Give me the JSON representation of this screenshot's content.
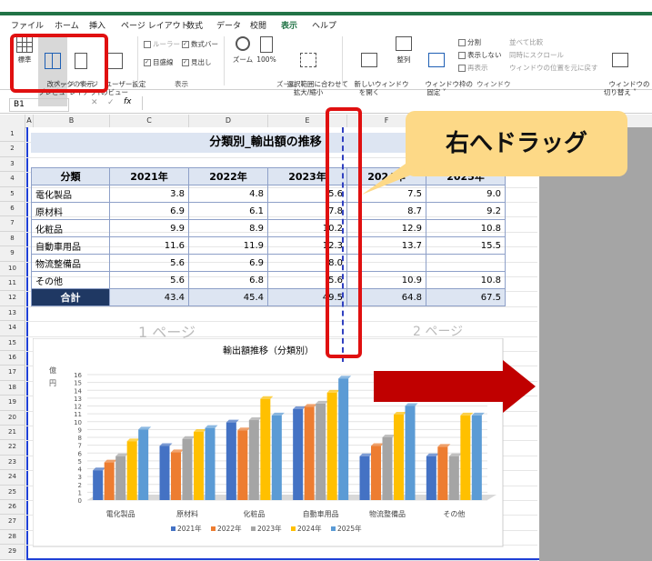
{
  "menu": [
    "ファイル",
    "ホーム",
    "挿入",
    "ページ レイアウト",
    "数式",
    "データ",
    "校閲",
    "表示",
    "ヘルプ"
  ],
  "menu_active": "表示",
  "ribbon": {
    "workbook_views": {
      "normal": "標準",
      "page_break": "改ページ\nプレビュー",
      "page_layout": "ページ\nレイアウト",
      "custom": "ユーザー設定\nのビュー",
      "group": "ブックの表示"
    },
    "show": {
      "ruler": "ルーラー",
      "formula_bar": "数式バー",
      "gridlines": "目盛線",
      "headings": "見出し",
      "group": "表示"
    },
    "zoom": {
      "zoom": "ズーム",
      "hundred": "100%",
      "selection": "選択範囲に合わせて\n拡大/縮小",
      "group": "ズーム"
    },
    "window": {
      "new_window": "新しいウィンドウ\nを開く",
      "arrange": "整列",
      "freeze": "ウィンドウ枠の\n固定 ˅",
      "split": "分割",
      "hide": "表示しない",
      "unhide": "再表示",
      "side": "並べて比較",
      "sync": "同時にスクロール",
      "reset": "ウィンドウの位置を元に戻す",
      "switch": "ウィンドウの\n切り替え ˅",
      "group": "ウィンドウ"
    }
  },
  "namebox": "B1",
  "fx": "fx",
  "columns": [
    "A",
    "B",
    "C",
    "D",
    "E",
    "F"
  ],
  "rows": [
    "1",
    "2",
    "3",
    "4",
    "5",
    "6",
    "7",
    "8",
    "9",
    "10",
    "11",
    "12",
    "13",
    "14",
    "15",
    "16",
    "17",
    "18",
    "19",
    "20",
    "21",
    "22",
    "23",
    "24",
    "25",
    "26",
    "27",
    "28",
    "29"
  ],
  "banner": "分類別_輸出額の推移",
  "table": {
    "headers": [
      "分類",
      "2021年",
      "2022年",
      "2023年",
      "2024年",
      "2025年"
    ],
    "rows": [
      [
        "電化製品",
        "3.8",
        "4.8",
        "5.6",
        "7.5",
        "9.0"
      ],
      [
        "原材料",
        "6.9",
        "6.1",
        "7.8",
        "8.7",
        "9.2"
      ],
      [
        "化粧品",
        "9.9",
        "8.9",
        "10.2",
        "12.9",
        "10.8"
      ],
      [
        "自動車用品",
        "11.6",
        "11.9",
        "12.3",
        "13.7",
        "15.5"
      ],
      [
        "物流整備品",
        "5.6",
        "6.9",
        "8.0",
        "",
        ""
      ],
      [
        "その他",
        "5.6",
        "6.8",
        "5.6",
        "10.9",
        "10.8"
      ]
    ],
    "total": [
      "合計",
      "43.4",
      "45.4",
      "49.5",
      "64.8",
      "67.5"
    ]
  },
  "page1": "1 ページ",
  "page2": "2 ページ",
  "callout": "右へドラッグ",
  "chart_data": {
    "type": "bar",
    "title": "輸出額推移（分類別）",
    "ylabel": "億\n円",
    "categories": [
      "電化製品",
      "原材料",
      "化粧品",
      "自動車用品",
      "物流整備品",
      "その他"
    ],
    "series": [
      {
        "name": "2021年",
        "values": [
          3.8,
          6.9,
          9.9,
          11.6,
          5.6,
          5.6
        ],
        "color": "#4472c4"
      },
      {
        "name": "2022年",
        "values": [
          4.8,
          6.1,
          8.9,
          11.9,
          6.9,
          6.8
        ],
        "color": "#ed7d31"
      },
      {
        "name": "2023年",
        "values": [
          5.6,
          7.8,
          10.2,
          12.3,
          8.0,
          5.6
        ],
        "color": "#a5a5a5"
      },
      {
        "name": "2024年",
        "values": [
          7.5,
          8.7,
          12.9,
          13.7,
          10.9,
          10.8
        ],
        "color": "#ffc000"
      },
      {
        "name": "2025年",
        "values": [
          9.0,
          9.2,
          10.8,
          15.5,
          12.0,
          10.8
        ],
        "color": "#5b9bd5"
      }
    ],
    "ylim": [
      0,
      16
    ],
    "yticks": [
      0,
      1,
      2,
      3,
      4,
      5,
      6,
      7,
      8,
      9,
      10,
      11,
      12,
      13,
      14,
      15,
      16
    ]
  }
}
